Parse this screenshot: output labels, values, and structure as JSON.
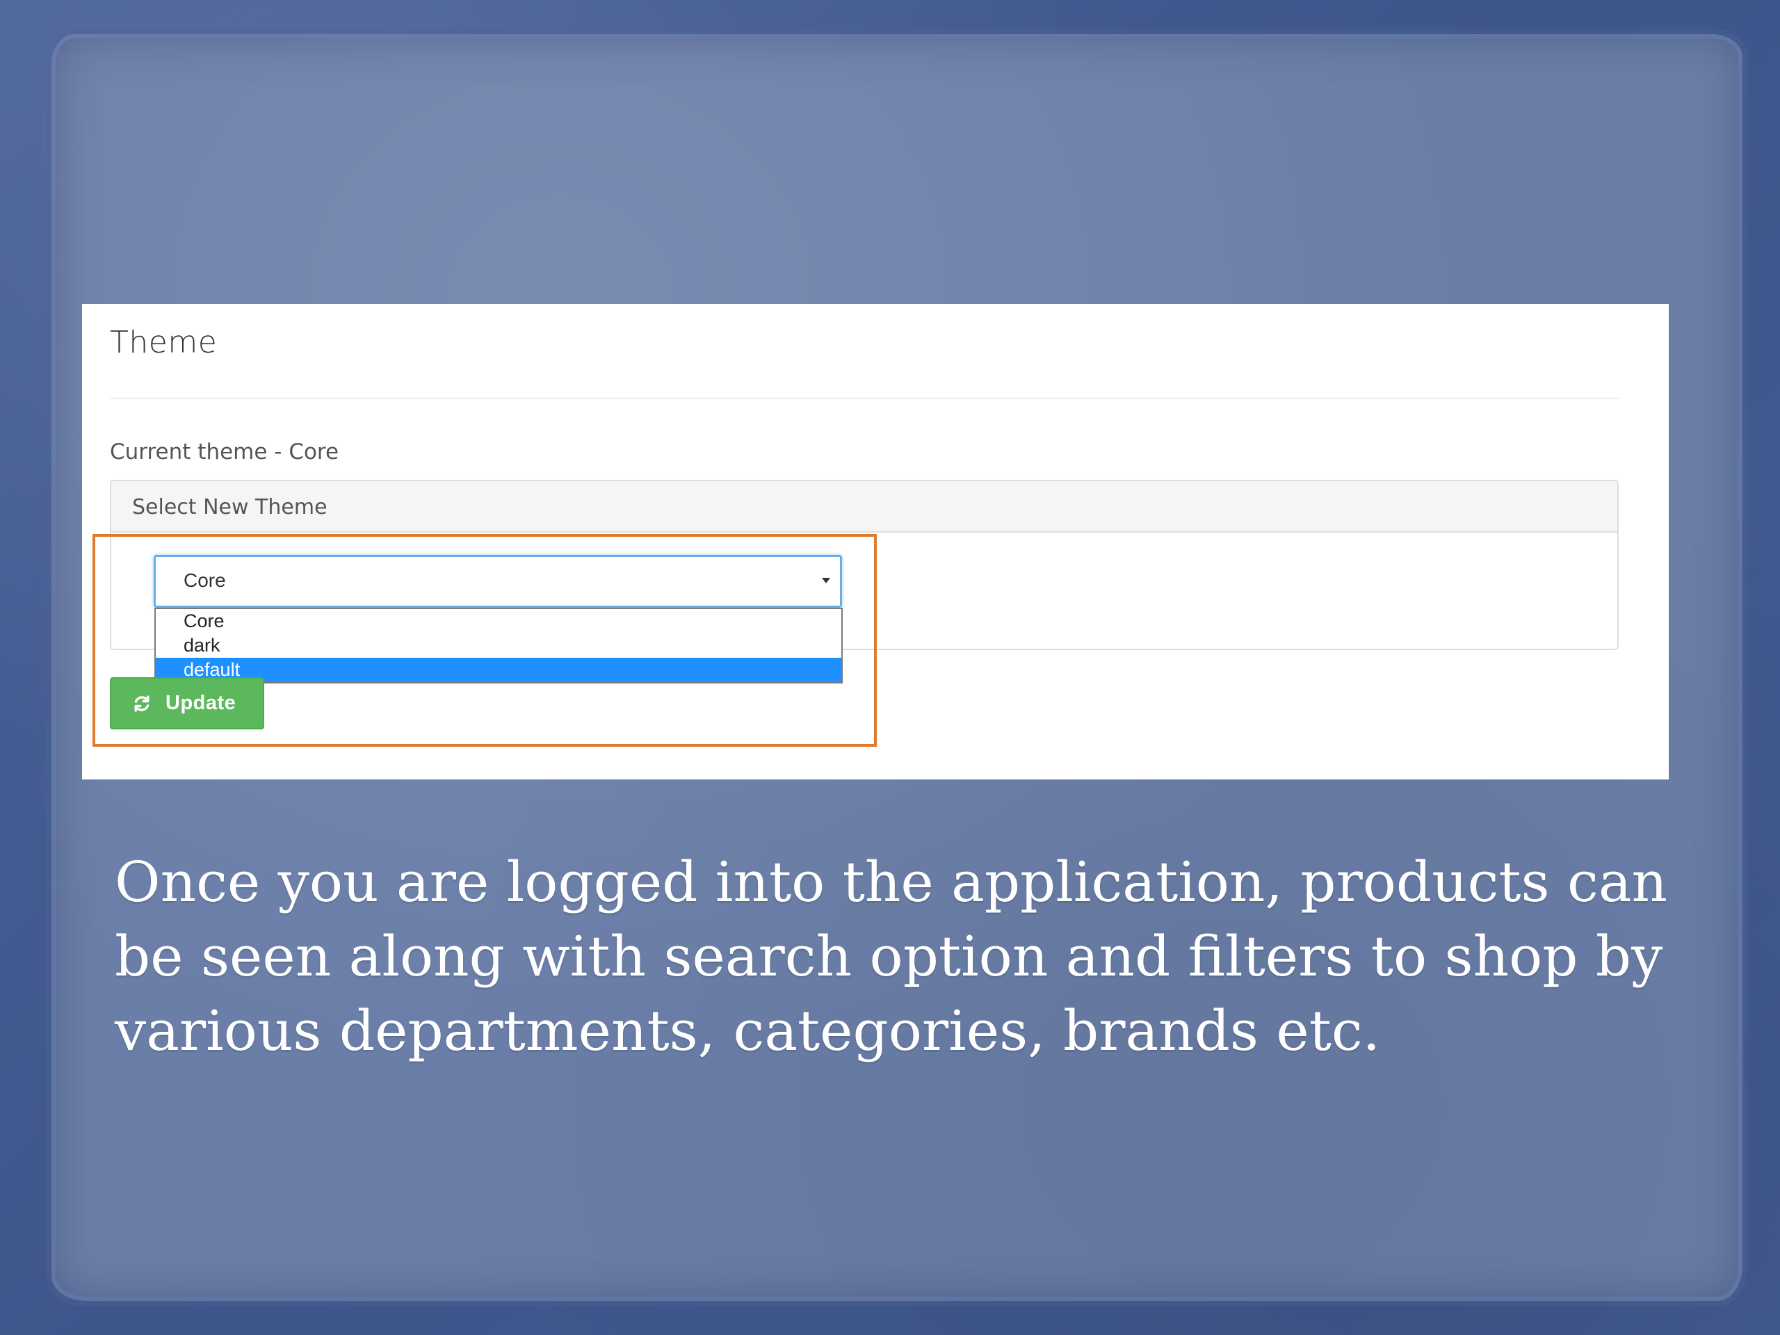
{
  "theme_card": {
    "title": "Theme",
    "current_theme_text": "Current theme - Core",
    "select_heading": "Select New Theme",
    "select": {
      "selected_value": "Core",
      "options": [
        "Core",
        "dark",
        "default"
      ],
      "highlighted_option": "default"
    },
    "update_button_label": "Update"
  },
  "caption": {
    "text": "Once you are logged into the application, products can be seen along with search option and filters to shop by various departments, categories, brands etc."
  },
  "colors": {
    "highlight_border": "#e07b2e",
    "update_button": "#5cb85c",
    "option_highlight": "#1e90ff",
    "background": "#3f578c"
  },
  "icons": {
    "update_button_icon": "refresh-icon",
    "select_arrow": "chevron-down-icon"
  }
}
